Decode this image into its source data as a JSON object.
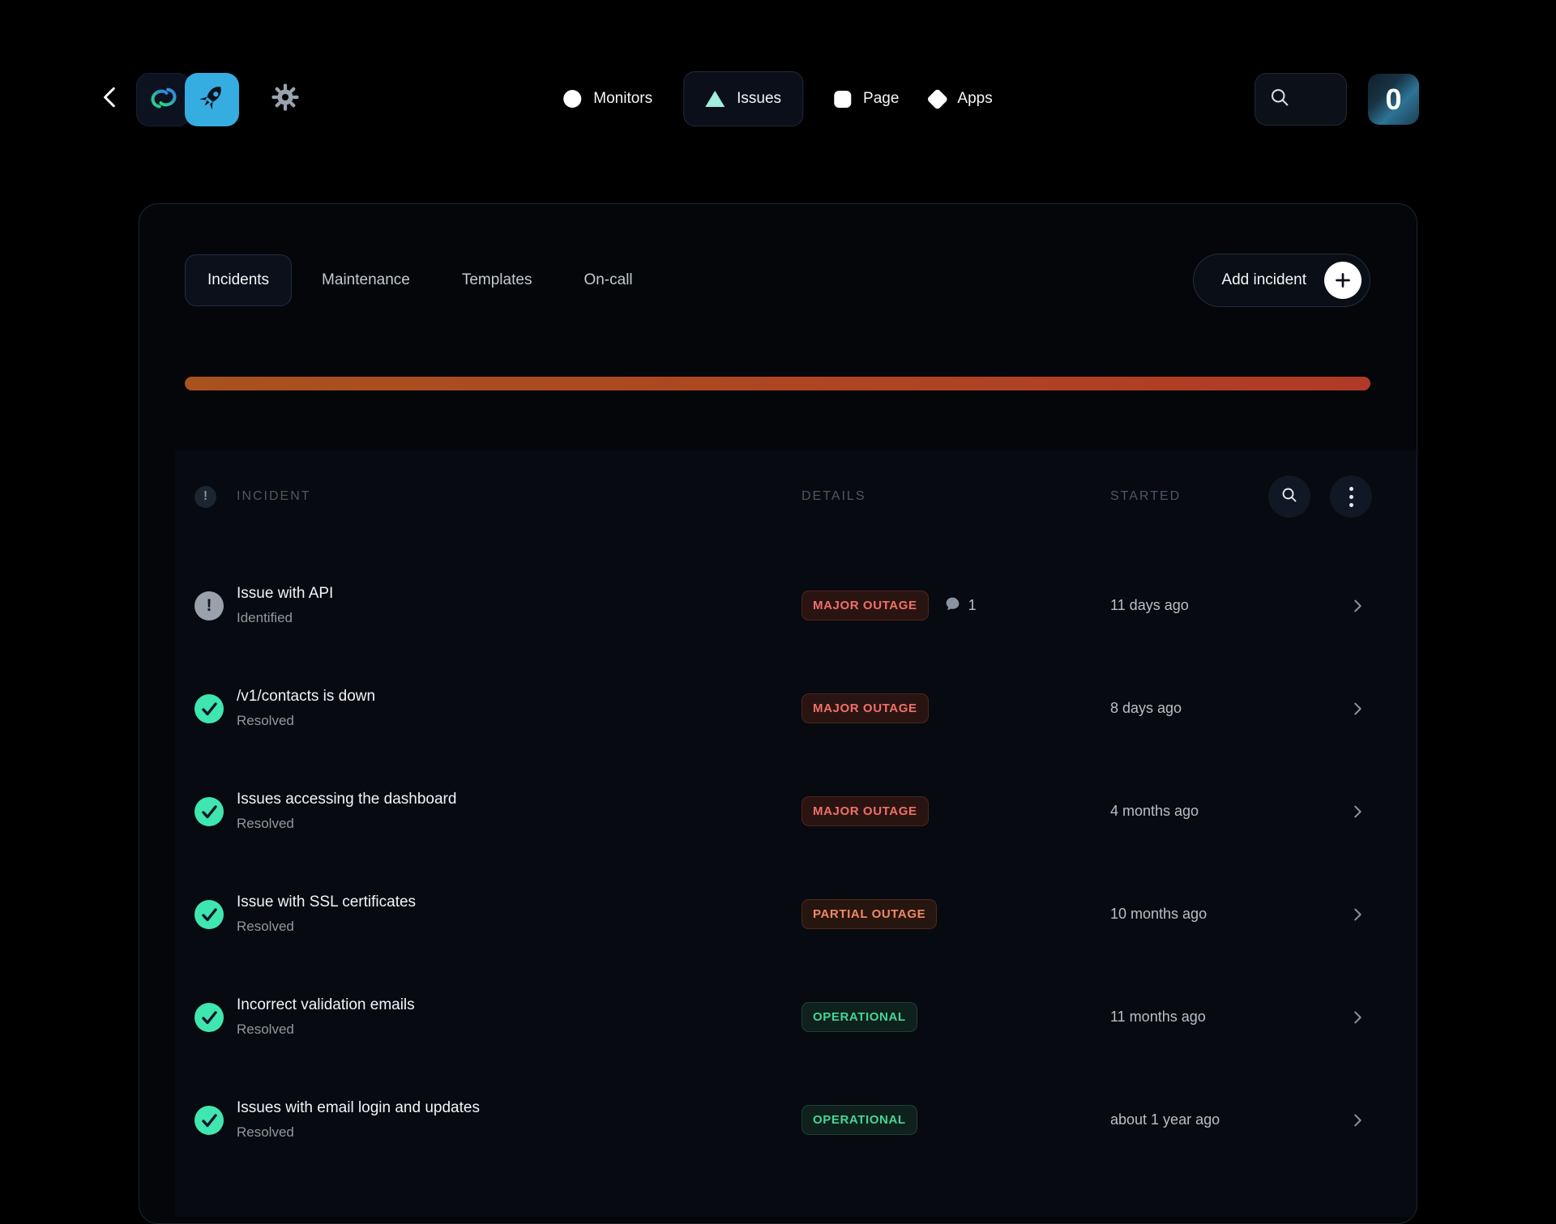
{
  "topbar": {
    "nav": {
      "monitors": "Monitors",
      "issues": "Issues",
      "page": "Page",
      "apps": "Apps"
    },
    "avatar_text": "0"
  },
  "panel": {
    "tabs": {
      "incidents": "Incidents",
      "maintenance": "Maintenance",
      "templates": "Templates",
      "oncall": "On-call"
    },
    "add_incident_label": "Add incident",
    "table": {
      "headers": {
        "incident": "INCIDENT",
        "details": "DETAILS",
        "started": "STARTED"
      },
      "rows": [
        {
          "title": "Issue with API",
          "status": "Identified",
          "badge": "MAJOR OUTAGE",
          "badge_type": "major",
          "comments": "1",
          "started": "11 days ago",
          "icon": "warning"
        },
        {
          "title": "/v1/contacts is down",
          "status": "Resolved",
          "badge": "MAJOR OUTAGE",
          "badge_type": "major",
          "started": "8 days ago",
          "icon": "check"
        },
        {
          "title": "Issues accessing the dashboard",
          "status": "Resolved",
          "badge": "MAJOR OUTAGE",
          "badge_type": "major",
          "started": "4 months ago",
          "icon": "check"
        },
        {
          "title": "Issue with SSL certificates",
          "status": "Resolved",
          "badge": "PARTIAL OUTAGE",
          "badge_type": "partial",
          "started": "10 months ago",
          "icon": "check"
        },
        {
          "title": "Incorrect validation emails",
          "status": "Resolved",
          "badge": "OPERATIONAL",
          "badge_type": "operational",
          "started": "11 months ago",
          "icon": "check"
        },
        {
          "title": "Issues with email login and updates",
          "status": "Resolved",
          "badge": "OPERATIONAL",
          "badge_type": "operational",
          "started": "about 1 year ago",
          "icon": "check"
        }
      ]
    }
  },
  "glyphs": {
    "warning": "!"
  },
  "colors": {
    "status_bar_from": "#a8521e",
    "status_bar_to": "#b03a27",
    "badge_major": "#ef7168",
    "badge_partial": "#ee8a62",
    "badge_operational": "#45d597",
    "check_icon_bg": "#3fe6b0",
    "logo_square_blue": "#36ade0",
    "issues_triangle": "#9ff0dd"
  }
}
